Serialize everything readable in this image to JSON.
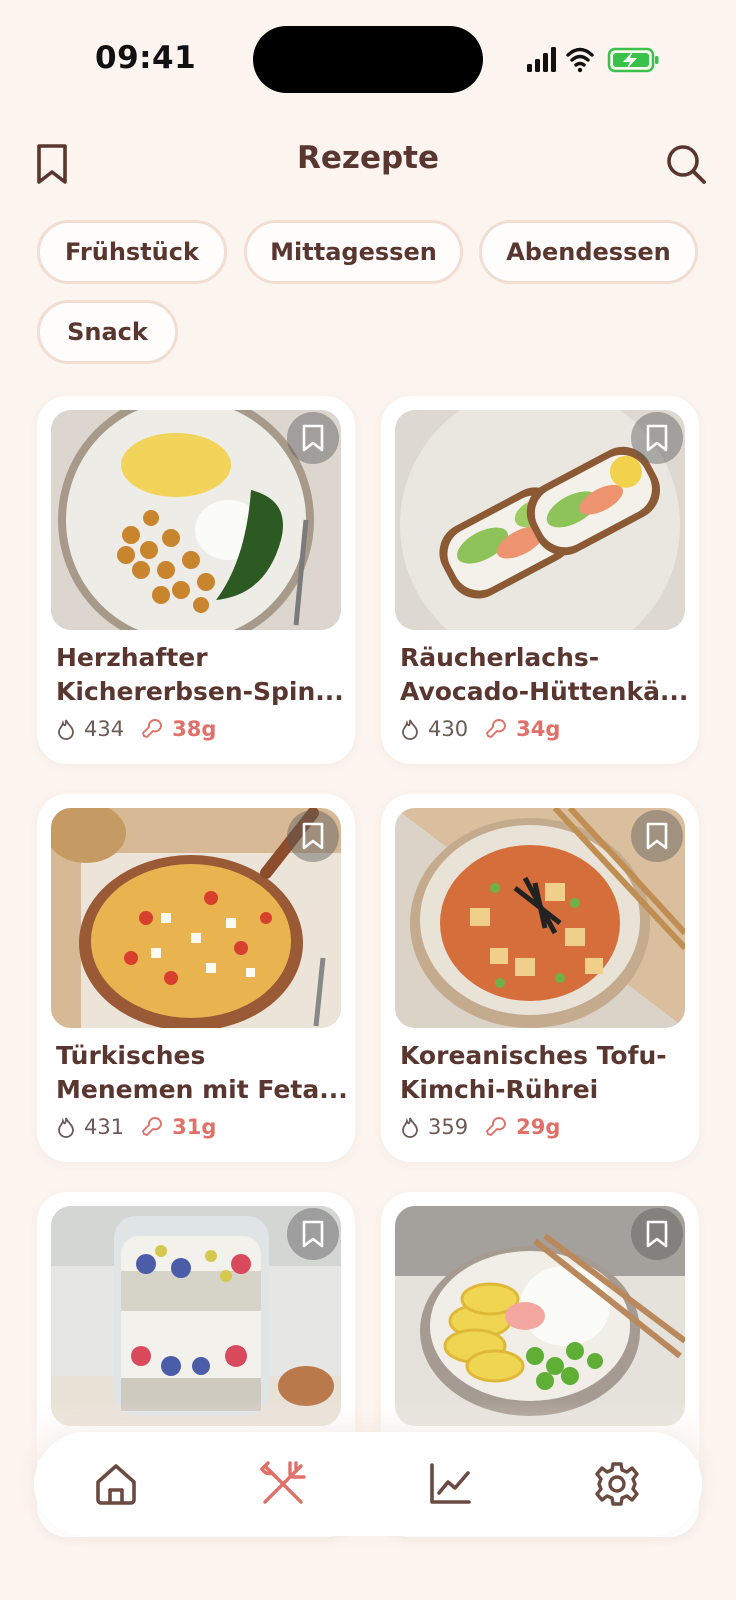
{
  "status": {
    "time": "09:41"
  },
  "header": {
    "title": "Rezepte"
  },
  "filters": [
    "Frühstück",
    "Mittagessen",
    "Abendessen",
    "Snack"
  ],
  "recipes": [
    {
      "name_line1": "Herzhafter",
      "name_line2": "Kichererbsen-Spin...",
      "kcal": "434",
      "protein": "38g"
    },
    {
      "name_line1": "Räucherlachs-",
      "name_line2": "Avocado-Hüttenkä...",
      "kcal": "430",
      "protein": "34g"
    },
    {
      "name_line1": "Türkisches",
      "name_line2": "Menemen mit Feta...",
      "kcal": "431",
      "protein": "31g"
    },
    {
      "name_line1": "Koreanisches Tofu-",
      "name_line2": "Kimchi-Rührei",
      "kcal": "359",
      "protein": "29g"
    }
  ],
  "colors": {
    "background": "#fcf4ef",
    "accent": "#e07068",
    "text": "#5a3630"
  },
  "nav": {
    "active": "recipes-icon"
  }
}
